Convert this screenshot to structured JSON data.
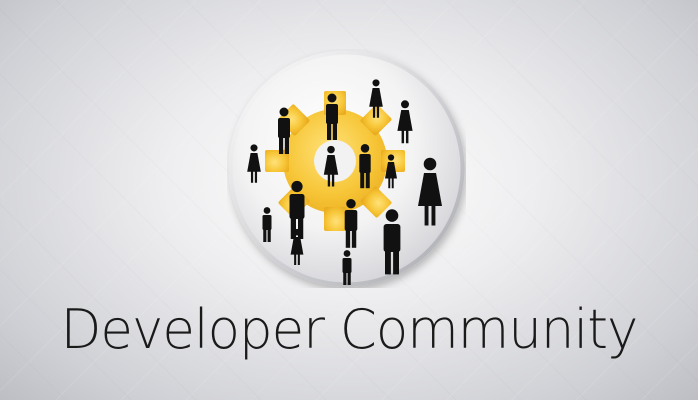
{
  "title": "Developer Community",
  "logo": {
    "icon": "gear-with-people-icon",
    "gear_color": "#f7c638",
    "figure_color": "#111111",
    "disc_color": "#f2f2f2"
  }
}
